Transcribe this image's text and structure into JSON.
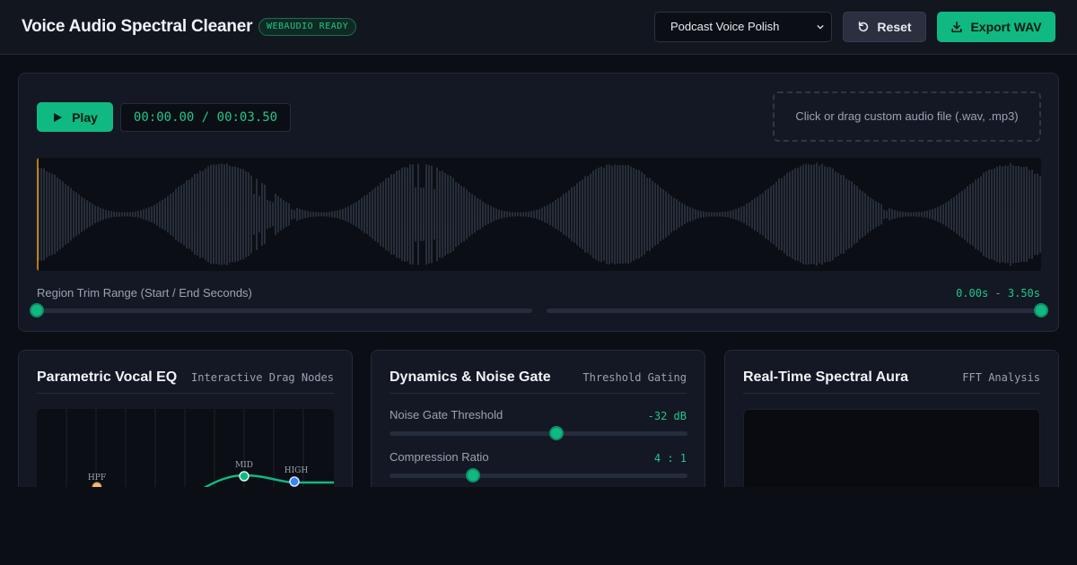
{
  "header": {
    "title": "Voice Audio Spectral Cleaner",
    "badge": "WEBAUDIO READY",
    "preset_selected": "Podcast Voice Polish",
    "reset_label": "Reset",
    "export_label": "Export WAV"
  },
  "player": {
    "play_label": "Play",
    "time": "00:00.00 / 00:03.50",
    "drop_hint": "Click or drag custom audio file (.wav, .mp3)"
  },
  "trim": {
    "label": "Region Trim Range (Start / End Seconds)",
    "value": "0.00s - 3.50s",
    "start_seconds": 0.0,
    "end_seconds": 3.5,
    "duration_seconds": 3.5
  },
  "eq_card": {
    "title": "Parametric Vocal EQ",
    "tag": "Interactive Drag Nodes",
    "nodes": [
      "HPF",
      "MID",
      "HIGH"
    ]
  },
  "dynamics_card": {
    "title": "Dynamics & Noise Gate",
    "tag": "Threshold Gating",
    "gate_label": "Noise Gate Threshold",
    "gate_value": "-32 dB",
    "gate_fraction": 0.56,
    "ratio_label": "Compression Ratio",
    "ratio_value": "4 : 1",
    "ratio_fraction": 0.28
  },
  "spectral_card": {
    "title": "Real-Time Spectral Aura",
    "tag": "FFT Analysis"
  },
  "colors": {
    "accent": "#10b981",
    "accent_text": "#22c58a",
    "background": "#0b0e14",
    "panel": "#131824",
    "playhead": "#f59e0b",
    "hpf_node": "#f5b97a",
    "high_node": "#3b82f6"
  }
}
